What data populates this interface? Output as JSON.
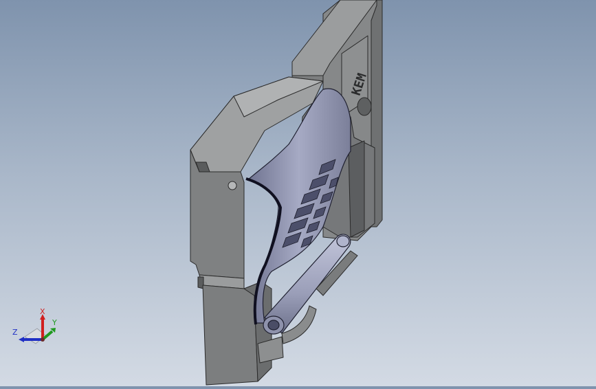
{
  "viewport": {
    "background_top": "#7f93ad",
    "background_bottom": "#d3dae4",
    "model": {
      "part_color": "#8b8d8e",
      "part_edge_color": "#2a2a2a",
      "sheet_color": "#9a9fb8",
      "roller_color": "#a4a8c2",
      "engraving_text": "KEM"
    }
  },
  "triad": {
    "x_label": "X",
    "y_label": "Y",
    "z_label": "Z",
    "x_color": "#d11f1f",
    "y_color": "#1f9a1f",
    "z_color": "#1f2fc4"
  }
}
